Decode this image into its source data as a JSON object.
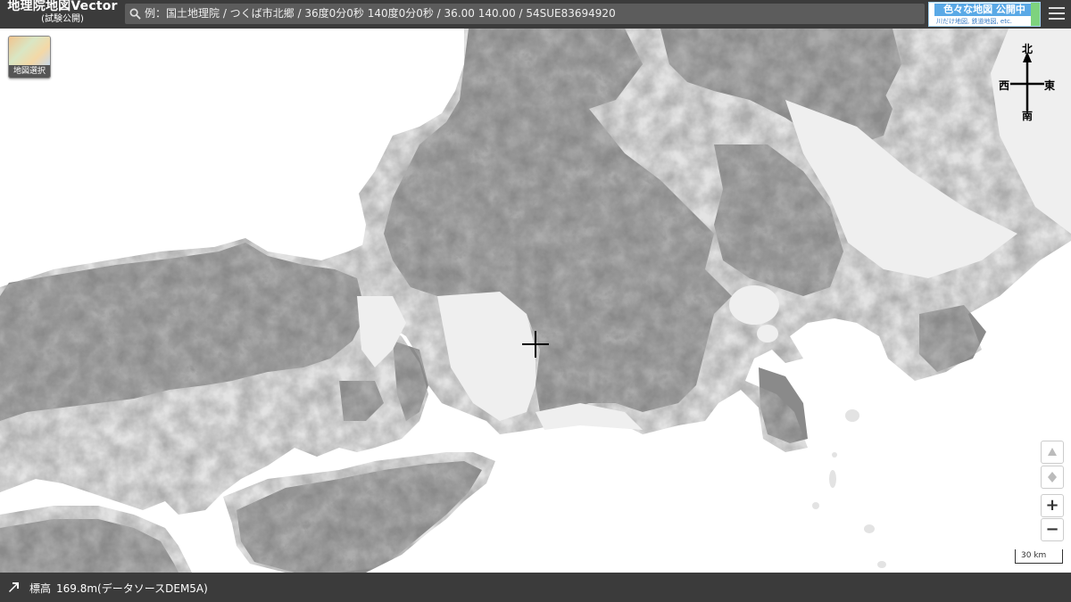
{
  "header": {
    "app_title": "地理院地図Vector",
    "app_subtitle": "(試験公開)",
    "search_placeholder": "例：国土地理院 / つくば市北郷 / 36度0分0秒 140度0分0秒  / 36.00 140.00 / 54SUE83694920",
    "banner_title": "色々な地図 公開中",
    "banner_sub": "川だけ地図, 鉄道地図, etc."
  },
  "map_selector": {
    "label": "地図選択"
  },
  "compass": {
    "north": "北",
    "west": "西",
    "east": "東",
    "south": "南"
  },
  "controls": {
    "zoom_in": "+",
    "zoom_out": "−"
  },
  "scale": {
    "label": "30 km"
  },
  "footer": {
    "elevation_label": "標高",
    "elevation_value": "169.8m(データソースDEM5A)"
  },
  "colors": {
    "header_bg": "#3b3b3b",
    "land_dark": "#6a6a6a",
    "land_light": "#d8d8d8",
    "sea": "#ffffff"
  }
}
